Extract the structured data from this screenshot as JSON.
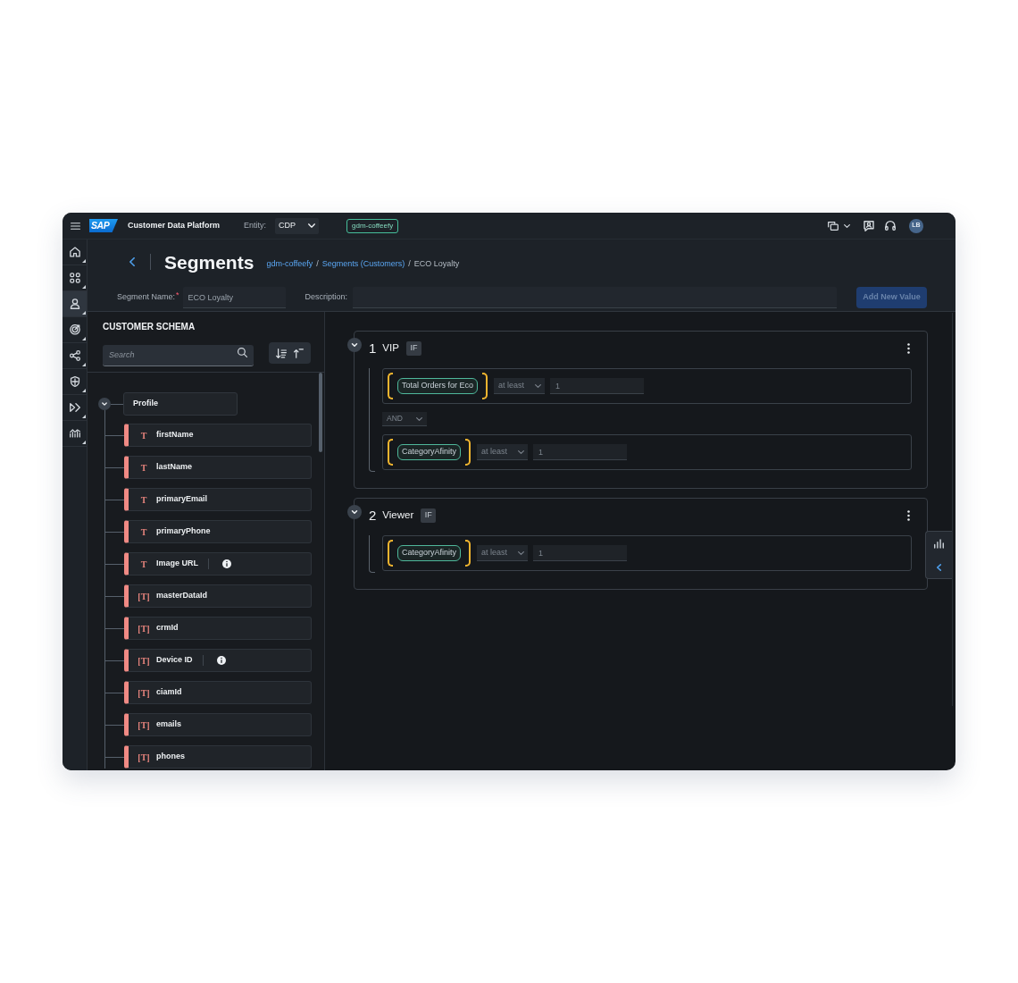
{
  "shell": {
    "logo": "SAP",
    "title": "Customer Data Platform",
    "entity_label": "Entity:",
    "entity_value": "CDP",
    "tenant": "gdm-coffeefy",
    "avatar": "LB"
  },
  "side_nav": [
    {
      "kind": "home",
      "selected": false
    },
    {
      "kind": "apps",
      "selected": false
    },
    {
      "kind": "person",
      "selected": true
    },
    {
      "kind": "target",
      "selected": false
    },
    {
      "kind": "share",
      "selected": false
    },
    {
      "kind": "shield",
      "selected": false
    },
    {
      "kind": "forward",
      "selected": false
    },
    {
      "kind": "chart",
      "selected": false
    }
  ],
  "page": {
    "title": "Segments",
    "breadcrumb": [
      {
        "kind": "link",
        "label": "gdm-coffeefy"
      },
      {
        "kind": "separator",
        "label": "/"
      },
      {
        "kind": "link",
        "label": "Segments (Customers)"
      },
      {
        "kind": "separator",
        "label": "/"
      },
      {
        "kind": "current",
        "label": "ECO Loyalty"
      }
    ]
  },
  "form": {
    "name_label": "Segment Name:",
    "required_mark": "*",
    "name_value": "ECO Loyalty",
    "description_label": "Description:",
    "add_button": {
      "label": "Add New Value",
      "disabled": true
    }
  },
  "schema": {
    "title": "CUSTOMER SCHEMA",
    "search_placeholder": "Search",
    "root": {
      "label": "Profile",
      "expanded": true,
      "children": [
        {
          "type_label": "T",
          "label": "firstName",
          "info": false
        },
        {
          "type_label": "T",
          "label": "lastName",
          "info": false
        },
        {
          "type_label": "T",
          "label": "primaryEmail",
          "info": false
        },
        {
          "type_label": "T",
          "label": "primaryPhone",
          "info": false
        },
        {
          "type_label": "T",
          "label": "Image URL",
          "info": true
        },
        {
          "type_label": "[T]",
          "label": "masterDataId",
          "info": false
        },
        {
          "type_label": "[T]",
          "label": "crmId",
          "info": false
        },
        {
          "type_label": "[T]",
          "label": "Device ID",
          "info": true
        },
        {
          "type_label": "[T]",
          "label": "ciamId",
          "info": false
        },
        {
          "type_label": "[T]",
          "label": "emails",
          "info": false
        },
        {
          "type_label": "[T]",
          "label": "phones",
          "info": false
        }
      ]
    }
  },
  "rules": [
    {
      "number": "1",
      "name": "VIP",
      "operator": "IF",
      "expanded": true,
      "items": [
        {
          "kind": "condition",
          "attribute": "Total Orders for Eco",
          "comparator": "at least",
          "value": "1"
        },
        {
          "kind": "join",
          "label": "AND"
        },
        {
          "kind": "condition",
          "attribute": "CategoryAfinity",
          "comparator": "at least",
          "value": "1"
        }
      ]
    },
    {
      "number": "2",
      "name": "Viewer",
      "operator": "IF",
      "expanded": true,
      "items": [
        {
          "kind": "condition",
          "attribute": "CategoryAfinity",
          "comparator": "at least",
          "value": "1"
        }
      ]
    }
  ]
}
